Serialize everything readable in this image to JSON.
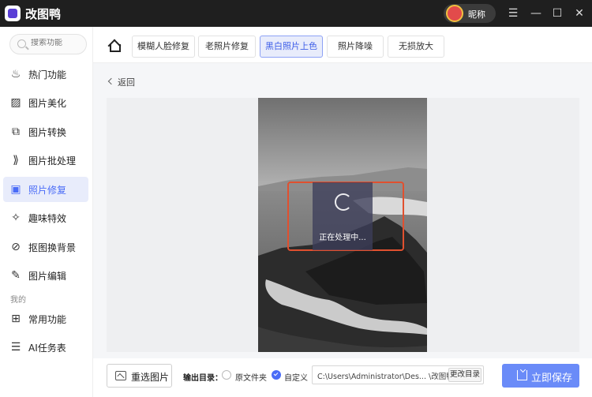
{
  "app": {
    "title": "改图鸭",
    "nickname": "昵称"
  },
  "window": {
    "menu": "☰",
    "minimize": "—",
    "maximize": "☐",
    "close": "✕"
  },
  "sidebar": {
    "search_placeholder": "搜索功能",
    "items": [
      {
        "label": "热门功能",
        "icon": "fire-icon"
      },
      {
        "label": "图片美化",
        "icon": "image-beauty-icon"
      },
      {
        "label": "图片转换",
        "icon": "image-convert-icon"
      },
      {
        "label": "图片批处理",
        "icon": "batch-icon"
      },
      {
        "label": "照片修复",
        "icon": "photo-repair-icon",
        "active": true
      },
      {
        "label": "趣味特效",
        "icon": "sparkle-icon"
      },
      {
        "label": "抠图换背景",
        "icon": "cutout-icon"
      },
      {
        "label": "图片编辑",
        "icon": "image-edit-icon"
      }
    ],
    "section_mine": "我的",
    "mine_items": [
      {
        "label": "常用功能",
        "icon": "grid-icon"
      },
      {
        "label": "AI任务表",
        "icon": "task-list-icon"
      }
    ]
  },
  "tabs": [
    {
      "label": "模糊人脸修复"
    },
    {
      "label": "老照片修复"
    },
    {
      "label": "黑白照片上色",
      "active": true
    },
    {
      "label": "照片降噪"
    },
    {
      "label": "无损放大"
    }
  ],
  "back": "返回",
  "processing": {
    "text": "正在处理中..."
  },
  "bottom": {
    "reselect": "重选图片",
    "output_label": "输出目录：",
    "option_original": "原文件夹",
    "option_custom": "自定义",
    "path": "C:\\Users\\Administrator\\Des... \\改图鸭",
    "change_dir": "更改目录",
    "save": "立即保存"
  },
  "colors": {
    "accent": "#4a6cf7",
    "save": "#6a8bf8",
    "highlight": "#e0502f"
  }
}
